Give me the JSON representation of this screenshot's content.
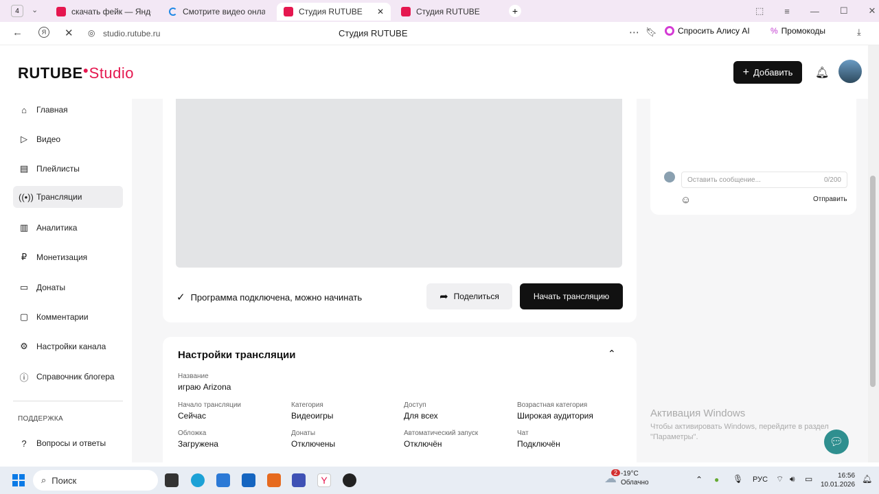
{
  "browser": {
    "tab_counter": "4",
    "tabs": [
      {
        "title": "скачать фейк — Яндекс: н",
        "color": "#e5174f"
      },
      {
        "title": "Смотрите видео онлайн,",
        "color": "#1e88e5"
      },
      {
        "title": "Студия RUTUBE",
        "color": "#e5174f"
      },
      {
        "title": "Студия RUTUBE",
        "color": "#e5174f"
      }
    ],
    "url": "studio.rutube.ru",
    "page_title": "Студия RUTUBE",
    "alice": "Спросить Алису AI",
    "promo": "Промокоды"
  },
  "header": {
    "logo_main": "RUTUBE",
    "logo_studio": "Studio",
    "add_label": "Добавить"
  },
  "sidebar": {
    "items": [
      {
        "label": "Главная",
        "icon": "home-icon"
      },
      {
        "label": "Видео",
        "icon": "video-icon"
      },
      {
        "label": "Плейлисты",
        "icon": "playlist-icon"
      },
      {
        "label": "Трансляции",
        "icon": "broadcast-icon"
      },
      {
        "label": "Аналитика",
        "icon": "analytics-icon"
      },
      {
        "label": "Монетизация",
        "icon": "ruble-icon"
      },
      {
        "label": "Донаты",
        "icon": "wallet-icon"
      },
      {
        "label": "Комментарии",
        "icon": "comment-icon"
      },
      {
        "label": "Настройки канала",
        "icon": "gear-icon"
      },
      {
        "label": "Справочник блогера",
        "icon": "info-icon"
      }
    ],
    "support_heading": "ПОДДЕРЖКА",
    "faq": "Вопросы и ответы"
  },
  "stream": {
    "status": "Программа подключена, можно начинать",
    "share": "Поделиться",
    "start": "Начать трансляцию"
  },
  "settings": {
    "title": "Настройки трансляции",
    "name_label": "Название",
    "name_value": "играю Arizona",
    "fields": [
      {
        "label": "Начало трансляции",
        "value": "Сейчас"
      },
      {
        "label": "Категория",
        "value": "Видеоигры"
      },
      {
        "label": "Доступ",
        "value": "Для всех"
      },
      {
        "label": "Возрастная категория",
        "value": "Широкая аудитория"
      },
      {
        "label": "Обложка",
        "value": "Загружена"
      },
      {
        "label": "Донаты",
        "value": "Отключены"
      },
      {
        "label": "Автоматический запуск",
        "value": "Отключён"
      },
      {
        "label": "Чат",
        "value": "Подключён"
      }
    ]
  },
  "chat": {
    "placeholder": "Оставить сообщение...",
    "counter": "0/200",
    "send": "Отправить"
  },
  "watermark": {
    "line1": "Активация Windows",
    "line2": "Чтобы активировать Windows, перейдите в раздел \"Параметры\"."
  },
  "taskbar": {
    "search": "Поиск",
    "weather_badge": "2",
    "temp": "-19°C",
    "weather": "Облачно",
    "lang": "РУС",
    "time": "16:56",
    "date": "10.01.2026"
  }
}
